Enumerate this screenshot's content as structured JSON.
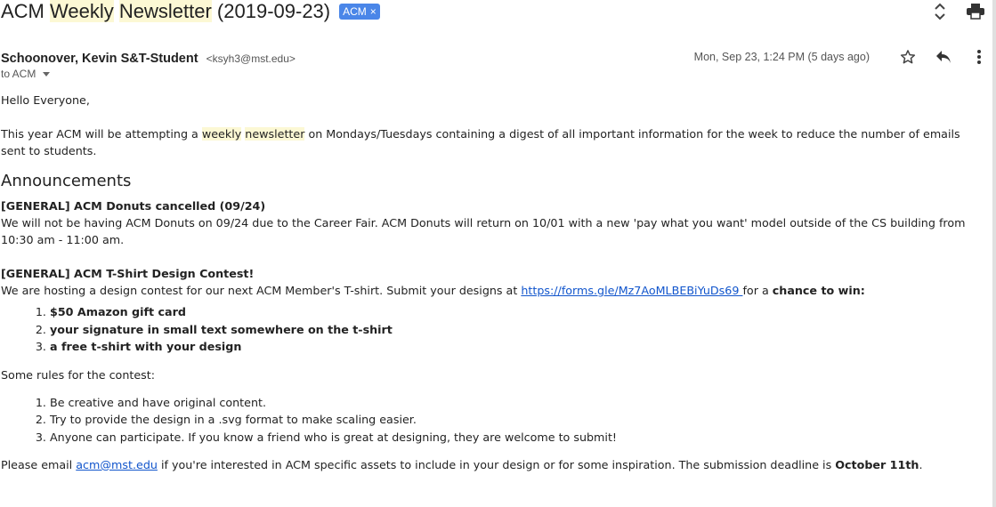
{
  "email": {
    "subject_prefix": "ACM",
    "subject_hl1": "Weekly",
    "subject_hl2": "Newsletter",
    "subject_suffix": "(2019-09-23)",
    "label": "ACM",
    "label_remove": "×",
    "sender_name": "Schoonover, Kevin S&T-Student",
    "sender_email": "<ksyh3@mst.edu>",
    "date": "Mon, Sep 23, 1:24 PM (5 days ago)",
    "to": "to ACM"
  },
  "icons": {
    "expand": "unfold-icon",
    "print": "print-icon",
    "star": "star-icon",
    "reply": "reply-icon",
    "more": "more-vert-icon"
  },
  "body": {
    "greeting": "Hello Everyone,",
    "intro_a": "This year ACM will be attempting a ",
    "intro_hl1": "weekly",
    "intro_hl2": "newsletter",
    "intro_b": " on Mondays/Tuesdays containing a digest of all important information for the week to reduce the number of emails sent to students.",
    "heading": "Announcements",
    "item1_title": "[GENERAL] ACM Donuts cancelled (09/24)",
    "item1_text": "We will not be having ACM Donuts on 09/24 due to the Career Fair. ACM Donuts will return on 10/01 with a new 'pay what you want' model outside of the CS building from 10:30 am - 11:00 am.",
    "item2_title": "[GENERAL] ACM T-Shirt Design Contest!",
    "item2_text_a": "We are hosting a design contest for our next ACM Member's T-shirt. Submit your designs at ",
    "item2_link": "https://forms.gle/Mz7AoMLBEBiYuDs69 ",
    "item2_text_b": "for a ",
    "item2_bold": "chance to win:",
    "prizes": [
      "$50 Amazon gift card",
      "your signature in small text somewhere on the t-shirt",
      "a free t-shirt with your design"
    ],
    "rules_intro": "Some rules for the contest:",
    "rules": [
      "Be creative and have original content.",
      "Try to provide the design in a .svg format to make scaling easier.",
      "Anyone can participate. If you know a friend who is great at designing, they are welcome to submit!"
    ],
    "closing_a": "Please email ",
    "closing_link": "acm@mst.edu",
    "closing_b": " if you're interested in ACM specific assets to include in your design or for some inspiration. The submission deadline is ",
    "closing_bold": "October 11th",
    "closing_c": "."
  }
}
